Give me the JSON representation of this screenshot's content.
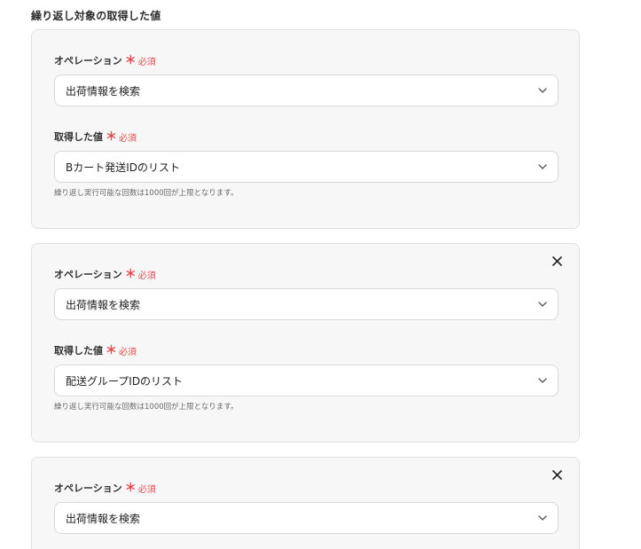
{
  "section": {
    "title": "繰り返し対象の取得した値"
  },
  "required_marker": "＊",
  "required_text": "必須",
  "cards": [
    {
      "operation": {
        "label": "オペレーション",
        "value": "出荷情報を検索"
      },
      "value_field": {
        "label": "取得した値",
        "value": "Bカート発送IDのリスト"
      },
      "hint": "繰り返し実行可能な回数は1000回が上限となります。",
      "closable": false
    },
    {
      "operation": {
        "label": "オペレーション",
        "value": "出荷情報を検索"
      },
      "value_field": {
        "label": "取得した値",
        "value": "配送グループIDのリスト"
      },
      "hint": "繰り返し実行可能な回数は1000回が上限となります。",
      "closable": true
    },
    {
      "operation": {
        "label": "オペレーション",
        "value": "出荷情報を検索"
      },
      "closable": true
    }
  ],
  "icons": {
    "close": "close-icon",
    "chevron": "chevron-down-icon"
  },
  "colors": {
    "required": "#e5484d",
    "card_bg": "#f7f7f7",
    "border": "#d9d9d9"
  }
}
